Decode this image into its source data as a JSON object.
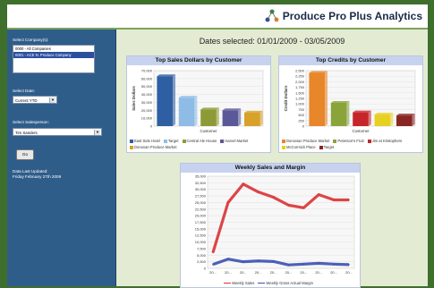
{
  "app": {
    "logo_text": "Produce Pro Plus Analytics"
  },
  "sidebar": {
    "company_label": "Select Company(s):",
    "companies": [
      "0000 - All Companies",
      "0001 - ACE N. Produce Company"
    ],
    "date_label": "Select Date:",
    "date_value": "Current YTD",
    "salesperson_label": "Select Salesperson:",
    "salesperson_value": "Tim Sanders",
    "go_label": "Go",
    "last_updated_label": "Data Last Updated:",
    "last_updated_value": "Friday February 27th 2009"
  },
  "main": {
    "dates_selected": "Dates selected: 01/01/2009 - 03/05/2009"
  },
  "colors": {
    "accent_green": "#3f6f2c",
    "sidebar_blue": "#2f5d8a"
  },
  "chart_data": [
    {
      "type": "bar",
      "title": "Top Sales Dollars by Customer",
      "ylabel": "Sales Dollars",
      "xlabel": "Customer",
      "ylim": [
        0,
        70000
      ],
      "yticks": [
        "0",
        "10,000",
        "20,000",
        "30,000",
        "40,000",
        "50,000",
        "60,000",
        "70,000"
      ],
      "categories": [
        "East Side Hotel",
        "Target",
        "Central Ale House",
        "Harvel Market",
        "Donovan Produce Market"
      ],
      "values": [
        63000,
        36000,
        21000,
        20000,
        17000
      ],
      "colors": [
        "#2e5fa3",
        "#8fbce6",
        "#8e9a35",
        "#5a5896",
        "#d8a12a"
      ]
    },
    {
      "type": "bar",
      "title": "Top Credits by Customer",
      "ylabel": "Credit Dollars",
      "xlabel": "Customer",
      "ylim": [
        0,
        2500
      ],
      "yticks": [
        "0",
        "250",
        "500",
        "750",
        "1,000",
        "1,250",
        "1,500",
        "1,750",
        "2,000",
        "2,250",
        "2,500"
      ],
      "categories": [
        "Donovian Produce Market",
        "Peterson's Fruit",
        "Jim at Kristophers",
        "McCormick Place",
        "Target"
      ],
      "values": [
        2400,
        1050,
        620,
        520,
        480
      ],
      "colors": [
        "#e8862a",
        "#8aa43a",
        "#c6262a",
        "#e6d020",
        "#8a2622"
      ]
    },
    {
      "type": "line",
      "title": "Weekly Sales and Margin",
      "ylim": [
        0,
        35000
      ],
      "yticks": [
        "0",
        "2,500",
        "5,000",
        "7,500",
        "10,000",
        "12,500",
        "15,000",
        "17,500",
        "20,000",
        "22,500",
        "25,000",
        "27,500",
        "30,000",
        "32,500",
        "35,000"
      ],
      "xticks": [
        "20...",
        "20...",
        "20...",
        "20...",
        "20...",
        "20...",
        "20...",
        "20...",
        "20...",
        "20..."
      ],
      "series": [
        {
          "name": "Weekly Sales",
          "color": "#d83232",
          "values": [
            6000,
            25000,
            32000,
            29000,
            27000,
            24000,
            23000,
            28000,
            26000,
            26000
          ]
        },
        {
          "name": "Weekly Gross Actual Margin",
          "color": "#3b4fb0",
          "values": [
            1500,
            3500,
            2500,
            2800,
            2600,
            1300,
            1600,
            1900,
            1600,
            1400
          ]
        }
      ]
    }
  ]
}
